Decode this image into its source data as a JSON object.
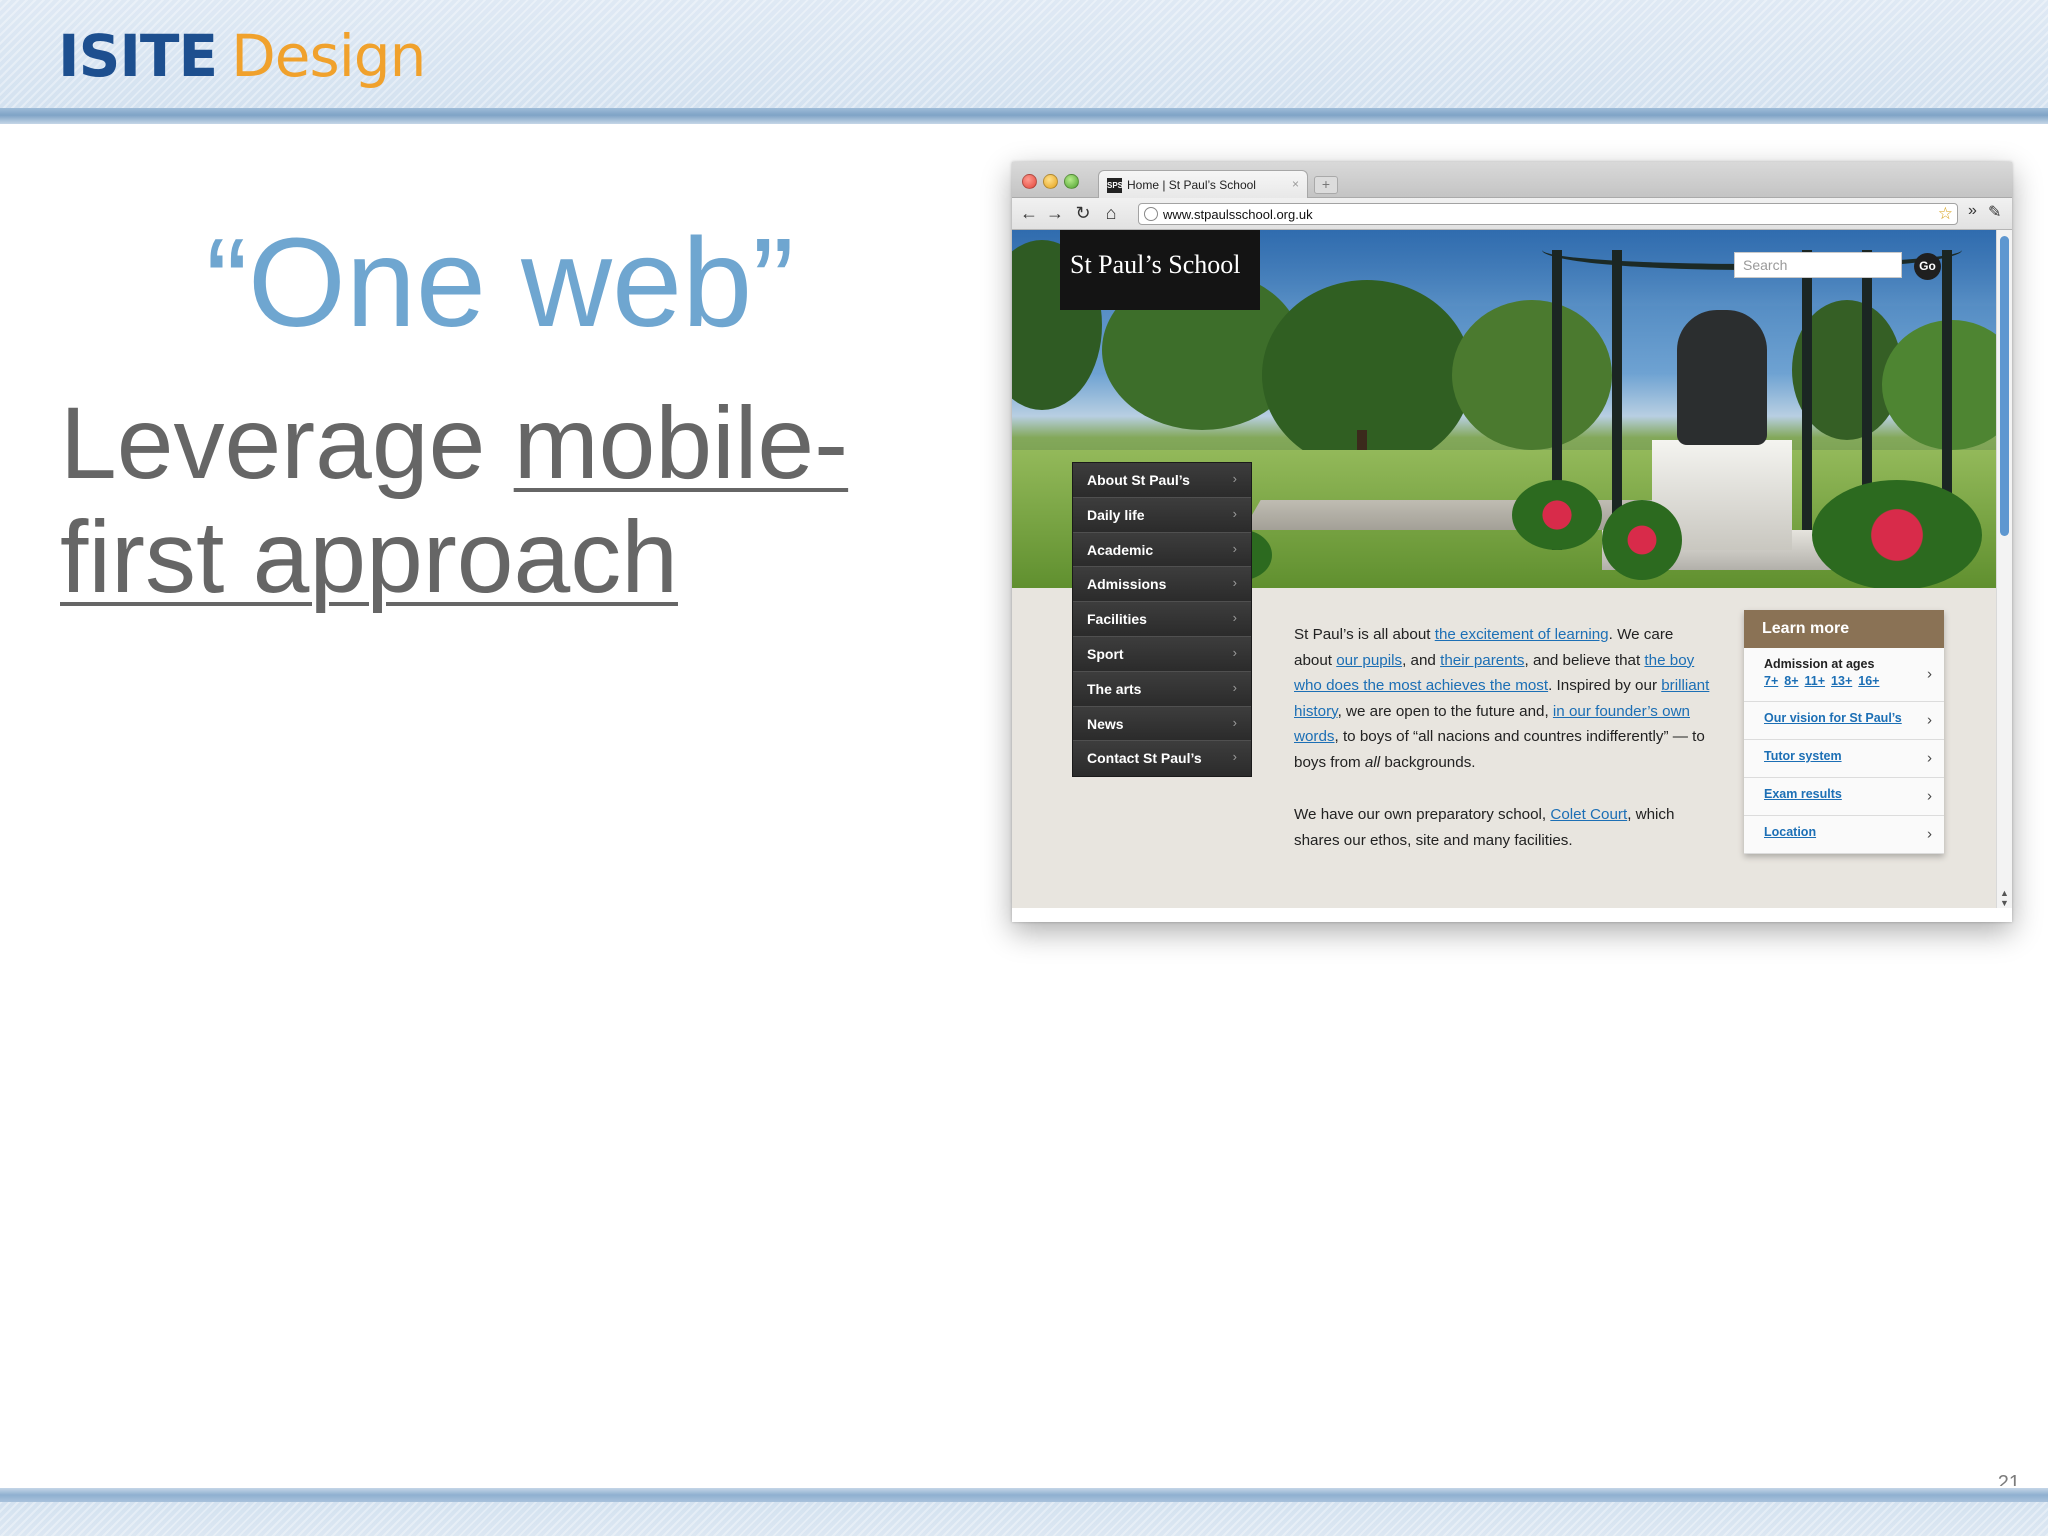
{
  "logo": {
    "part1": "ISITE",
    "part2": "Design"
  },
  "slide": {
    "title": "“One web”",
    "body_plain": "Leverage",
    "body_linked_1": "mobile-",
    "body_linked_2": "first approach",
    "number": "21"
  },
  "browser": {
    "tab_favicon": "SPS",
    "tab_title": "Home | St Paul’s School",
    "tab_close": "×",
    "new_tab": "+",
    "back": "←",
    "forward": "→",
    "reload": "↻",
    "home": "⌂",
    "url": "www.stpaulsschool.org.uk",
    "bookmark_star": "☆",
    "more": "»",
    "wrench": "✎"
  },
  "site": {
    "title": "St Paul’s School",
    "search_placeholder": "Search",
    "go_label": "Go",
    "nav": [
      {
        "label": "About St Paul’s"
      },
      {
        "label": "Daily life"
      },
      {
        "label": "Academic"
      },
      {
        "label": "Admissions"
      },
      {
        "label": "Facilities"
      },
      {
        "label": "Sport"
      },
      {
        "label": "The arts"
      },
      {
        "label": "News"
      },
      {
        "label": "Contact St Paul’s"
      }
    ],
    "nav_chevron": "›",
    "intro": {
      "t1": "St Paul’s is all about ",
      "l1": "the excitement of learning",
      "t2": ". We care about ",
      "l2": "our pupils",
      "t3": ", and ",
      "l3": "their parents",
      "t4": ", and believe that ",
      "l4": "the boy who does the most achieves the most",
      "t5": ". Inspired by our ",
      "l5": "brilliant history",
      "t6": ", we are open to the future and, ",
      "l6": "in our founder’s own words",
      "t7": ", to boys of “all nacions and countres indifferently” — to boys from ",
      "em": "all",
      "t8": " backgrounds.",
      "p2_t1": "We have our own preparatory school, ",
      "p2_l1": "Colet Court",
      "p2_t2": ", which shares our ethos, site and many facilities."
    },
    "learn_more": {
      "heading": "Learn more",
      "admission_title": "Admission at ages",
      "ages": [
        "7+",
        "8+",
        "11+",
        "13+",
        "16+"
      ],
      "links": [
        "Our vision for St Paul’s",
        "Tutor system",
        "Exam results",
        "Location"
      ],
      "chevron": "›"
    }
  },
  "colors": {
    "title_blue": "#6fa6d0",
    "body_gray": "#666666",
    "logo_blue": "#1d4f8f",
    "logo_orange": "#f0a12c",
    "learn_more_brown": "#8a7255",
    "link_blue": "#1c6fb5"
  }
}
